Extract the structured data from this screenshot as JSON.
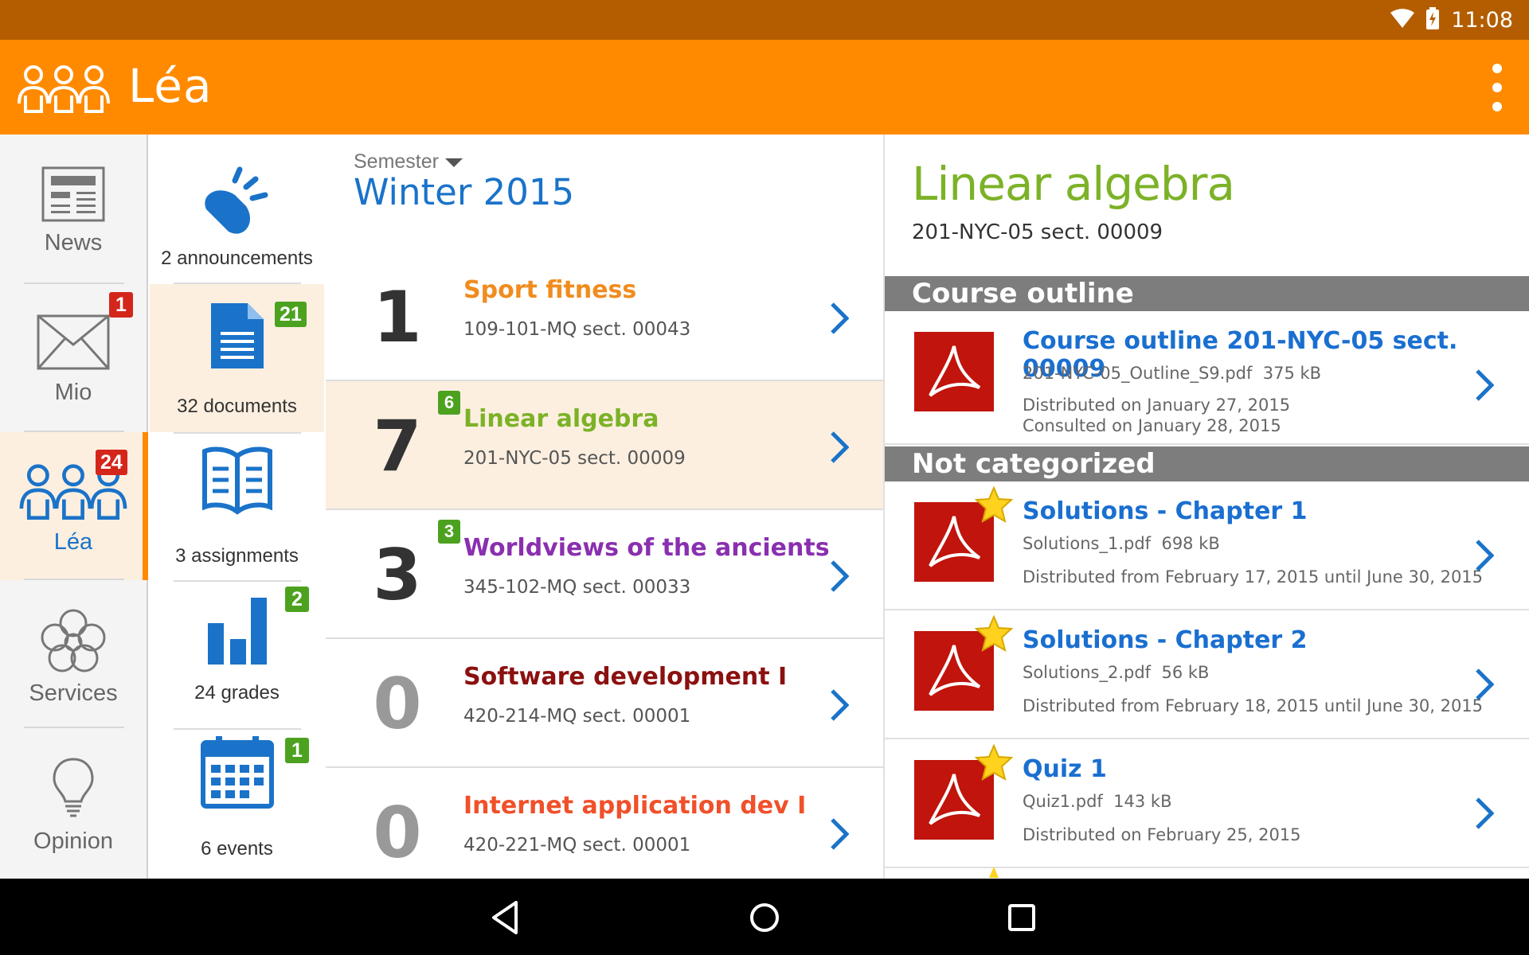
{
  "status_bar": {
    "time": "11:08"
  },
  "app_bar": {
    "title": "Léa"
  },
  "rail": {
    "items": [
      {
        "label": "News",
        "badge": ""
      },
      {
        "label": "Mio",
        "badge": "1"
      },
      {
        "label": "Léa",
        "badge": "24"
      },
      {
        "label": "Services",
        "badge": ""
      },
      {
        "label": "Opinion",
        "badge": ""
      }
    ]
  },
  "tools": {
    "items": [
      {
        "label": "2 announcements",
        "badge": ""
      },
      {
        "label": "32 documents",
        "badge": "21"
      },
      {
        "label": "3 assignments",
        "badge": ""
      },
      {
        "label": "24 grades",
        "badge": "2"
      },
      {
        "label": "6 events",
        "badge": "1"
      }
    ]
  },
  "courses": {
    "semester_label": "Semester",
    "semester_value": "Winter 2015",
    "items": [
      {
        "count": "1",
        "badge": "",
        "name": "Sport fitness",
        "code": "109-101-MQ sect. 00043",
        "color": "#f08c1e"
      },
      {
        "count": "7",
        "badge": "6",
        "name": "Linear algebra",
        "code": "201-NYC-05 sect. 00009",
        "color": "#7cb227"
      },
      {
        "count": "3",
        "badge": "3",
        "name": "Worldviews of the ancients",
        "code": "345-102-MQ sect. 00033",
        "color": "#8a2fb0"
      },
      {
        "count": "0",
        "badge": "",
        "name": "Software development I",
        "code": "420-214-MQ sect. 00001",
        "color": "#8b1010"
      },
      {
        "count": "0",
        "badge": "",
        "name": "Internet application dev I",
        "code": "420-221-MQ sect. 00001",
        "color": "#f0502a"
      }
    ]
  },
  "details": {
    "title": "Linear algebra",
    "code": "201-NYC-05 sect. 00009",
    "sections": [
      {
        "heading": "Course outline"
      },
      {
        "heading": "Not categorized"
      }
    ],
    "documents": [
      {
        "name": "Course outline 201-NYC-05 sect. 00009",
        "file": "201-NYC-05_Outline_S9.pdf",
        "size": "375 kB",
        "line1": "Distributed on January 27, 2015",
        "line2": "Consulted on January 28, 2015",
        "starred": false
      },
      {
        "name": "Solutions - Chapter 1",
        "file": "Solutions_1.pdf",
        "size": "698 kB",
        "line1": "Distributed from February 17, 2015 until June 30, 2015",
        "line2": "",
        "starred": true
      },
      {
        "name": "Solutions - Chapter 2",
        "file": "Solutions_2.pdf",
        "size": "56 kB",
        "line1": "Distributed from February 18, 2015 until June 30, 2015",
        "line2": "",
        "starred": true
      },
      {
        "name": "Quiz 1",
        "file": "Quiz1.pdf",
        "size": "143 kB",
        "line1": "Distributed on February 25, 2015",
        "line2": "",
        "starred": true
      }
    ]
  },
  "colors": {
    "accent": "#ff8a00",
    "status_bar": "#b45d00",
    "link_blue": "#1a73c9",
    "badge_red": "#d4261b",
    "badge_green": "#4ca21f"
  }
}
